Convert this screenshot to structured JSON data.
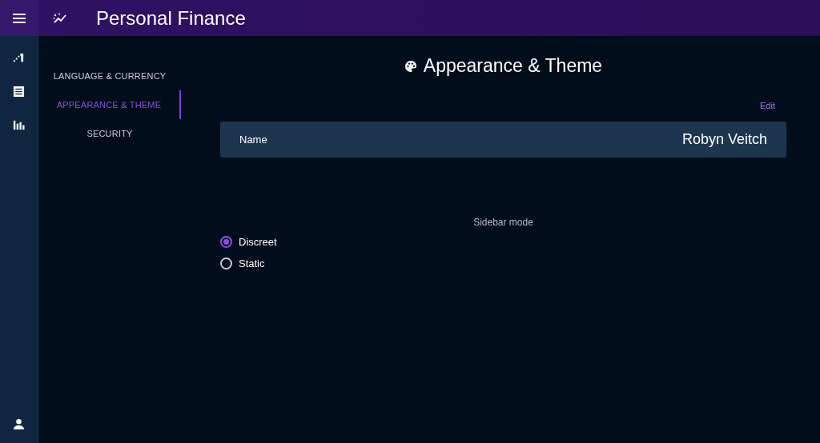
{
  "app_bar": {
    "title": "Personal Finance"
  },
  "settings_nav": [
    {
      "label": "LANGUAGE & CURRENCY",
      "selected": false
    },
    {
      "label": "APPEARANCE & THEME",
      "selected": true
    },
    {
      "label": "SECURITY",
      "selected": false
    }
  ],
  "section": {
    "title": "Appearance & Theme",
    "edit": "Edit",
    "name_label": "Name",
    "name_value": "Robyn Veitch"
  },
  "sidebar_mode": {
    "label": "Sidebar mode",
    "options": [
      {
        "label": "Discreet",
        "selected": true
      },
      {
        "label": "Static",
        "selected": false
      }
    ]
  }
}
